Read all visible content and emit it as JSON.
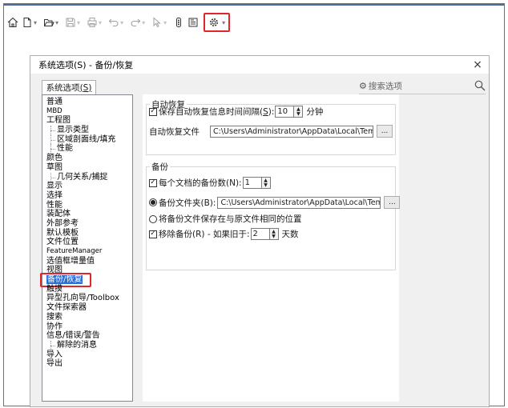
{
  "dialog": {
    "title": "系统选项(S) - 备份/恢复",
    "close_glyph": "×",
    "tab_label": "系统选项",
    "tab_mnemonic": "(S)",
    "search_placeholder": "搜索选项"
  },
  "tree": [
    {
      "label": "普通",
      "level": 0
    },
    {
      "label": "MBD",
      "level": 0,
      "small": true
    },
    {
      "label": "工程图",
      "level": 0
    },
    {
      "label": "显示类型",
      "level": 1
    },
    {
      "label": "区域剖面线/填充",
      "level": 1
    },
    {
      "label": "性能",
      "level": 1
    },
    {
      "label": "颜色",
      "level": 0
    },
    {
      "label": "草图",
      "level": 0
    },
    {
      "label": "几何关系/捕捉",
      "level": 1
    },
    {
      "label": "显示",
      "level": 0
    },
    {
      "label": "选择",
      "level": 0
    },
    {
      "label": "性能",
      "level": 0
    },
    {
      "label": "装配体",
      "level": 0
    },
    {
      "label": "外部参考",
      "level": 0
    },
    {
      "label": "默认模板",
      "level": 0
    },
    {
      "label": "文件位置",
      "level": 0
    },
    {
      "label": "FeatureManager",
      "level": 0,
      "small": true
    },
    {
      "label": "选值框增量值",
      "level": 0
    },
    {
      "label": "视图",
      "level": 0
    },
    {
      "label": "备份/恢复",
      "level": 0,
      "selected": true
    },
    {
      "label": "触摸",
      "level": 0
    },
    {
      "label": "异型孔向导/Toolbox",
      "level": 0
    },
    {
      "label": "文件探索器",
      "level": 0
    },
    {
      "label": "搜索",
      "level": 0
    },
    {
      "label": "协作",
      "level": 0
    },
    {
      "label": "信息/错误/警告",
      "level": 0
    },
    {
      "label": "解除的消息",
      "level": 1
    },
    {
      "label": "导入",
      "level": 0
    },
    {
      "label": "导出",
      "level": 0
    }
  ],
  "autorecover": {
    "group_title": "自动恢复",
    "save_info_checked": true,
    "save_info_label": "保存自动恢复信息时间间隔(",
    "save_info_mnemonic": "S",
    "save_info_close": "):",
    "interval_value": "10",
    "interval_unit": "分钟",
    "file_label": "自动恢复文件",
    "file_path": "C:\\Users\\Administrator\\AppData\\Local\\TempSW备份目录"
  },
  "backup": {
    "group_title": "备份",
    "per_doc_checked": true,
    "per_doc_label": "每个文档的备份数(N):",
    "per_doc_value": "1",
    "folder_label": "备份文件夹(B):",
    "folder_path": "C:\\Users\\Administrator\\AppData\\Local\\TempSW备份目录",
    "same_location_label": "将备份文件保存在与原文件相同的位置",
    "remove_checked": true,
    "remove_label": "移除备份(R) - 如果旧于:",
    "remove_value": "2",
    "remove_unit": "天数"
  },
  "glyphs": {
    "check": "✓",
    "spin_up": "▲",
    "spin_down": "▼",
    "browse": "...",
    "dropdown": "▾",
    "gear": "⚙",
    "magnifier": "⚲"
  }
}
